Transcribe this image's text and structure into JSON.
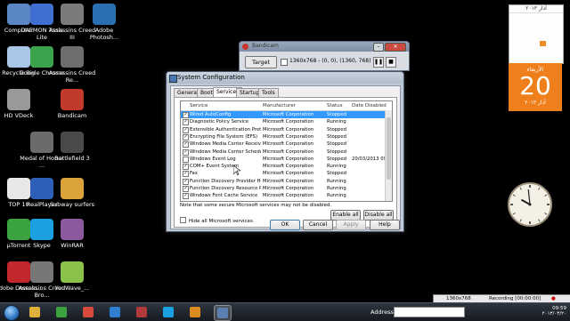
{
  "desktop_icons": [
    {
      "label": "Computer",
      "icon": "computer-icon",
      "color": "#5b86c6"
    },
    {
      "label": "DAEMON Tools Lite",
      "icon": "daemon-tools-icon",
      "color": "#3f6fd1"
    },
    {
      "label": "Assassins Creed III",
      "icon": "assassins-creed-icon",
      "color": "#7b7b7b"
    },
    {
      "label": "Adobe Photosh...",
      "icon": "photoshop-icon",
      "color": "#2b6fb3"
    },
    {
      "label": "Recycle Bin",
      "icon": "recycle-bin-icon",
      "color": "#a8c6e6"
    },
    {
      "label": "Google Chrome",
      "icon": "chrome-icon",
      "color": "#3ba34c"
    },
    {
      "label": "Assassins Creed Re...",
      "icon": "assassins-creed-revelations-icon",
      "color": "#6e6e6e"
    },
    {
      "label": "HD VDeck",
      "icon": "hd-vdeck-icon",
      "color": "#999999"
    },
    {
      "label": "Bandicam",
      "icon": "bandicam-icon",
      "color": "#c23a2c"
    },
    {
      "label": "Medal of Honor ...",
      "icon": "medal-of-honor-icon",
      "color": "#6b6b6b"
    },
    {
      "label": "Battlefield 3",
      "icon": "battlefield-icon",
      "color": "#4a4a4a"
    },
    {
      "label": "TOP 10",
      "icon": "document-icon",
      "color": "#e8e8e8"
    },
    {
      "label": "RealPlayer",
      "icon": "realplayer-icon",
      "color": "#2d5fb8"
    },
    {
      "label": "Subway surfers",
      "icon": "subway-surfers-icon",
      "color": "#d9a23a"
    },
    {
      "label": "µTorrent",
      "icon": "utorrent-icon",
      "color": "#3aa33f"
    },
    {
      "label": "Skype",
      "icon": "skype-icon",
      "color": "#1ba1e2"
    },
    {
      "label": "WinRAR",
      "icon": "winrar-icon",
      "color": "#8b5a9e"
    },
    {
      "label": "Adobe Downlo...",
      "icon": "adobe-download-icon",
      "color": "#c0282d"
    },
    {
      "label": "Assassins Creed Bro...",
      "icon": "assassins-creed-brotherhood-icon",
      "color": "#777777"
    },
    {
      "label": "YouWave_...",
      "icon": "youwave-android-icon",
      "color": "#8bc34a"
    }
  ],
  "bandicam": {
    "title": "Bandicam",
    "target_label": "Target",
    "resolution_text": "1360x768 - (0, 0), (1360, 768)"
  },
  "syscfg": {
    "title": "System Configuration",
    "tabs": [
      "General",
      "Boot",
      "Services",
      "Startup",
      "Tools"
    ],
    "active_tab": "Services",
    "columns": [
      "Service",
      "Manufacturer",
      "Status",
      "Date Disabled"
    ],
    "rows": [
      {
        "checked": true,
        "service": "Wired AutoConfig",
        "manufacturer": "Microsoft Corporation",
        "status": "Stopped",
        "date": "",
        "selected": true
      },
      {
        "checked": true,
        "service": "Diagnostic Policy Service",
        "manufacturer": "Microsoft Corporation",
        "status": "Running",
        "date": ""
      },
      {
        "checked": true,
        "service": "Extensible Authentication Protocol",
        "manufacturer": "Microsoft Corporation",
        "status": "Stopped",
        "date": ""
      },
      {
        "checked": true,
        "service": "Encrypting File System (EFS)",
        "manufacturer": "Microsoft Corporation",
        "status": "Stopped",
        "date": ""
      },
      {
        "checked": true,
        "service": "Windows Media Center Receiver...",
        "manufacturer": "Microsoft Corporation",
        "status": "Stopped",
        "date": ""
      },
      {
        "checked": true,
        "service": "Windows Media Center Schedule...",
        "manufacturer": "Microsoft Corporation",
        "status": "Stopped",
        "date": ""
      },
      {
        "checked": false,
        "service": "Windows Event Log",
        "manufacturer": "Microsoft Corporation",
        "status": "Stopped",
        "date": "20/03/2013 09:..."
      },
      {
        "checked": true,
        "service": "COM+ Event System",
        "manufacturer": "Microsoft Corporation",
        "status": "Running",
        "date": ""
      },
      {
        "checked": true,
        "service": "Fax",
        "manufacturer": "Microsoft Corporation",
        "status": "Stopped",
        "date": ""
      },
      {
        "checked": true,
        "service": "Function Discovery Provider Host",
        "manufacturer": "Microsoft Corporation",
        "status": "Running",
        "date": ""
      },
      {
        "checked": true,
        "service": "Function Discovery Resource Pu...",
        "manufacturer": "Microsoft Corporation",
        "status": "Running",
        "date": ""
      },
      {
        "checked": true,
        "service": "Windows Font Cache Service",
        "manufacturer": "Microsoft Corporation",
        "status": "Running",
        "date": ""
      }
    ],
    "note": "Note that some secure Microsoft services may not be disabled.",
    "enable_all": "Enable all",
    "disable_all": "Disable all",
    "hide_ms": "Hide all Microsoft services",
    "ok": "OK",
    "cancel": "Cancel",
    "apply": "Apply",
    "help": "Help"
  },
  "calendar": {
    "header": "آذار ٢٠١٣",
    "day_name": "الأربعاء",
    "day_number": "20",
    "month_year": "آذار ٢٠١٣",
    "today_index": 23,
    "accent": "#ef7f1a"
  },
  "clock": {
    "hour": 9,
    "minute": 59
  },
  "taskbar": {
    "apps": [
      "explorer-icon",
      "utorrent-icon",
      "chrome-icon",
      "internet-explorer-icon",
      "flag-icon",
      "skype-icon",
      "media-player-icon",
      "system-configuration-icon"
    ],
    "address_label": "Address",
    "time": "09:59",
    "date": "٢٠١٣/٠٣/٢٠"
  },
  "recbar": {
    "resolution": "1360x768",
    "recording": "Recording [00:00:00]"
  }
}
